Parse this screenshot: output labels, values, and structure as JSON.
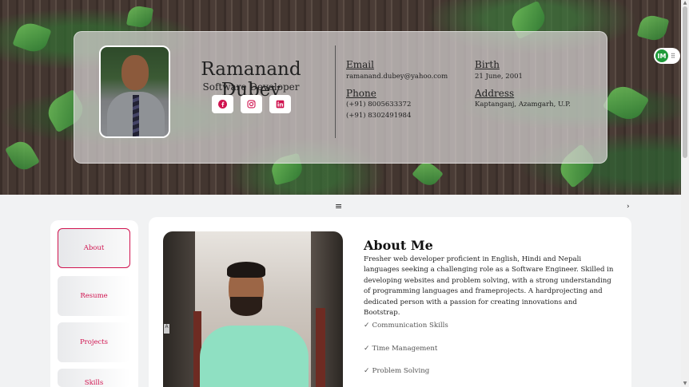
{
  "profile": {
    "name": "Ramanand Dubey",
    "role": "Software Developer",
    "email_label": "Email",
    "email": "ramanand.dubey@yahoo.com",
    "birth_label": "Birth",
    "birth": "21 June, 2001",
    "phone_label": "Phone",
    "phones": [
      "(+91) 8005633372",
      "(+91) 8302491984"
    ],
    "address_label": "Address",
    "address": "Kaptanganj, Azamgarh, U.P.",
    "socials": [
      "facebook-icon",
      "instagram-icon",
      "linkedin-icon"
    ]
  },
  "extension": {
    "badge": "IM",
    "menu": "⠿"
  },
  "toolbar": {
    "menu_icon": "≡",
    "next_icon": "›"
  },
  "sidebar": {
    "items": [
      {
        "label": "About",
        "active": true
      },
      {
        "label": "Resume",
        "active": false
      },
      {
        "label": "Projects",
        "active": false
      },
      {
        "label": "Skills",
        "active": false
      }
    ]
  },
  "about": {
    "title": "About Me",
    "text": "Fresher web developer proficient in English, Hindi and Nepali languages seeking a challenging role as a Software Engineer. Skilled in developing websites and problem solving, with a strong understanding of programming languages and frameprojects. A hardprojecting and dedicated person with a passion for creating innovations and Bootstrap.",
    "skills": [
      "Communication Skills",
      "Time Management",
      "Problem Solving"
    ],
    "photo_tag": "A"
  },
  "colors": {
    "accent": "#d0134f",
    "glass": "#d7d2d2"
  }
}
